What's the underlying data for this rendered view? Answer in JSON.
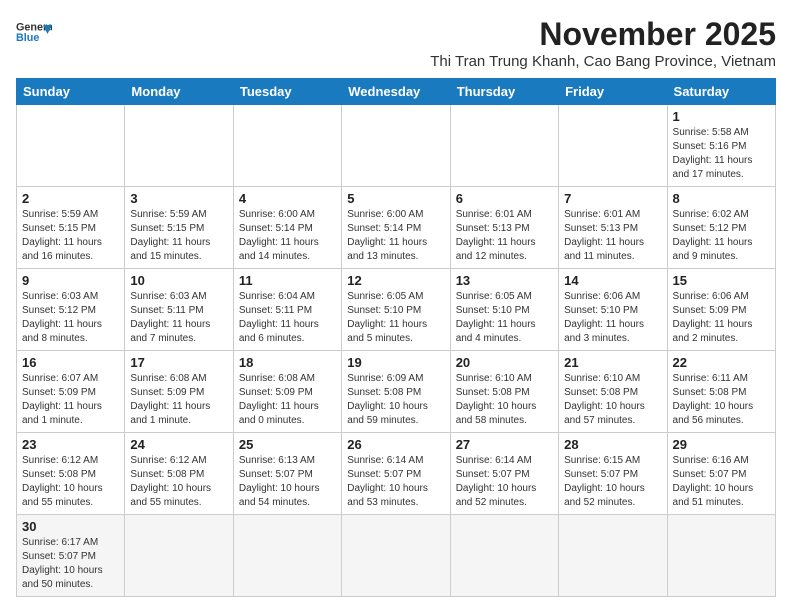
{
  "logo": {
    "line1": "General",
    "line2": "Blue"
  },
  "title": "November 2025",
  "subtitle": "Thi Tran Trung Khanh, Cao Bang Province, Vietnam",
  "days_of_week": [
    "Sunday",
    "Monday",
    "Tuesday",
    "Wednesday",
    "Thursday",
    "Friday",
    "Saturday"
  ],
  "weeks": [
    [
      {
        "day": "",
        "info": ""
      },
      {
        "day": "",
        "info": ""
      },
      {
        "day": "",
        "info": ""
      },
      {
        "day": "",
        "info": ""
      },
      {
        "day": "",
        "info": ""
      },
      {
        "day": "",
        "info": ""
      },
      {
        "day": "1",
        "info": "Sunrise: 5:58 AM\nSunset: 5:16 PM\nDaylight: 11 hours and 17 minutes."
      }
    ],
    [
      {
        "day": "2",
        "info": "Sunrise: 5:59 AM\nSunset: 5:15 PM\nDaylight: 11 hours and 16 minutes."
      },
      {
        "day": "3",
        "info": "Sunrise: 5:59 AM\nSunset: 5:15 PM\nDaylight: 11 hours and 15 minutes."
      },
      {
        "day": "4",
        "info": "Sunrise: 6:00 AM\nSunset: 5:14 PM\nDaylight: 11 hours and 14 minutes."
      },
      {
        "day": "5",
        "info": "Sunrise: 6:00 AM\nSunset: 5:14 PM\nDaylight: 11 hours and 13 minutes."
      },
      {
        "day": "6",
        "info": "Sunrise: 6:01 AM\nSunset: 5:13 PM\nDaylight: 11 hours and 12 minutes."
      },
      {
        "day": "7",
        "info": "Sunrise: 6:01 AM\nSunset: 5:13 PM\nDaylight: 11 hours and 11 minutes."
      },
      {
        "day": "8",
        "info": "Sunrise: 6:02 AM\nSunset: 5:12 PM\nDaylight: 11 hours and 9 minutes."
      }
    ],
    [
      {
        "day": "9",
        "info": "Sunrise: 6:03 AM\nSunset: 5:12 PM\nDaylight: 11 hours and 8 minutes."
      },
      {
        "day": "10",
        "info": "Sunrise: 6:03 AM\nSunset: 5:11 PM\nDaylight: 11 hours and 7 minutes."
      },
      {
        "day": "11",
        "info": "Sunrise: 6:04 AM\nSunset: 5:11 PM\nDaylight: 11 hours and 6 minutes."
      },
      {
        "day": "12",
        "info": "Sunrise: 6:05 AM\nSunset: 5:10 PM\nDaylight: 11 hours and 5 minutes."
      },
      {
        "day": "13",
        "info": "Sunrise: 6:05 AM\nSunset: 5:10 PM\nDaylight: 11 hours and 4 minutes."
      },
      {
        "day": "14",
        "info": "Sunrise: 6:06 AM\nSunset: 5:10 PM\nDaylight: 11 hours and 3 minutes."
      },
      {
        "day": "15",
        "info": "Sunrise: 6:06 AM\nSunset: 5:09 PM\nDaylight: 11 hours and 2 minutes."
      }
    ],
    [
      {
        "day": "16",
        "info": "Sunrise: 6:07 AM\nSunset: 5:09 PM\nDaylight: 11 hours and 1 minute."
      },
      {
        "day": "17",
        "info": "Sunrise: 6:08 AM\nSunset: 5:09 PM\nDaylight: 11 hours and 1 minute."
      },
      {
        "day": "18",
        "info": "Sunrise: 6:08 AM\nSunset: 5:09 PM\nDaylight: 11 hours and 0 minutes."
      },
      {
        "day": "19",
        "info": "Sunrise: 6:09 AM\nSunset: 5:08 PM\nDaylight: 10 hours and 59 minutes."
      },
      {
        "day": "20",
        "info": "Sunrise: 6:10 AM\nSunset: 5:08 PM\nDaylight: 10 hours and 58 minutes."
      },
      {
        "day": "21",
        "info": "Sunrise: 6:10 AM\nSunset: 5:08 PM\nDaylight: 10 hours and 57 minutes."
      },
      {
        "day": "22",
        "info": "Sunrise: 6:11 AM\nSunset: 5:08 PM\nDaylight: 10 hours and 56 minutes."
      }
    ],
    [
      {
        "day": "23",
        "info": "Sunrise: 6:12 AM\nSunset: 5:08 PM\nDaylight: 10 hours and 55 minutes."
      },
      {
        "day": "24",
        "info": "Sunrise: 6:12 AM\nSunset: 5:08 PM\nDaylight: 10 hours and 55 minutes."
      },
      {
        "day": "25",
        "info": "Sunrise: 6:13 AM\nSunset: 5:07 PM\nDaylight: 10 hours and 54 minutes."
      },
      {
        "day": "26",
        "info": "Sunrise: 6:14 AM\nSunset: 5:07 PM\nDaylight: 10 hours and 53 minutes."
      },
      {
        "day": "27",
        "info": "Sunrise: 6:14 AM\nSunset: 5:07 PM\nDaylight: 10 hours and 52 minutes."
      },
      {
        "day": "28",
        "info": "Sunrise: 6:15 AM\nSunset: 5:07 PM\nDaylight: 10 hours and 52 minutes."
      },
      {
        "day": "29",
        "info": "Sunrise: 6:16 AM\nSunset: 5:07 PM\nDaylight: 10 hours and 51 minutes."
      }
    ],
    [
      {
        "day": "30",
        "info": "Sunrise: 6:17 AM\nSunset: 5:07 PM\nDaylight: 10 hours and 50 minutes."
      },
      {
        "day": "",
        "info": ""
      },
      {
        "day": "",
        "info": ""
      },
      {
        "day": "",
        "info": ""
      },
      {
        "day": "",
        "info": ""
      },
      {
        "day": "",
        "info": ""
      },
      {
        "day": "",
        "info": ""
      }
    ]
  ]
}
